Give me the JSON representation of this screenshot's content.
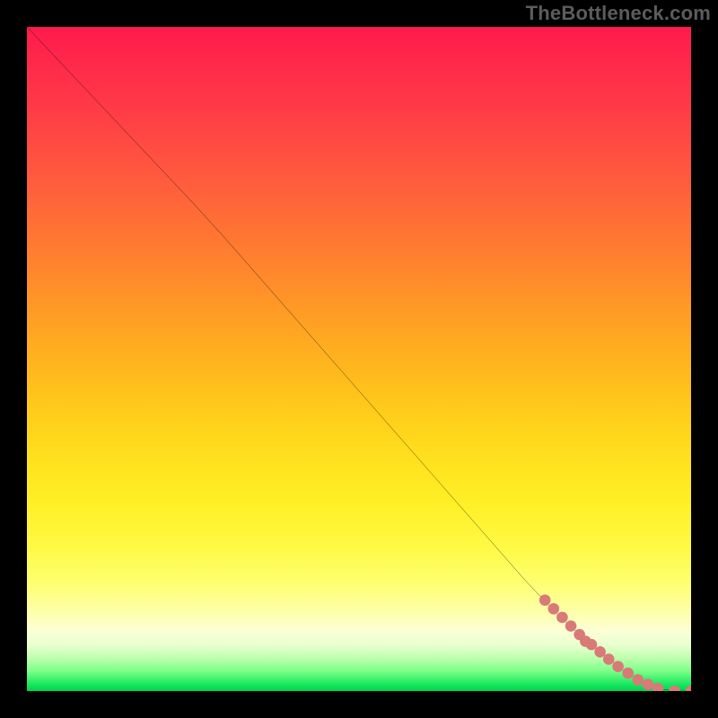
{
  "watermark": "TheBottleneck.com",
  "chart_data": {
    "type": "line",
    "title": "",
    "xlabel": "",
    "ylabel": "",
    "x_range": [
      0,
      100
    ],
    "y_range": [
      0,
      100
    ],
    "gradient_stops": [
      {
        "pct": 0,
        "color": "#ff1a4d"
      },
      {
        "pct": 25,
        "color": "#ff6a39"
      },
      {
        "pct": 50,
        "color": "#ffb520"
      },
      {
        "pct": 75,
        "color": "#fff234"
      },
      {
        "pct": 90,
        "color": "#fdffc0"
      },
      {
        "pct": 100,
        "color": "#00d24f"
      }
    ],
    "series": [
      {
        "name": "curve",
        "kind": "line",
        "color": "#000000",
        "x": [
          0,
          5,
          10,
          15,
          20,
          25,
          30,
          35,
          40,
          45,
          50,
          55,
          60,
          65,
          70,
          75,
          80,
          85,
          90,
          92,
          94,
          96,
          98,
          100
        ],
        "y": [
          100,
          94.7,
          89.4,
          84.1,
          78.8,
          73.5,
          68.0,
          62.3,
          56.6,
          50.9,
          45.2,
          39.5,
          33.8,
          28.1,
          22.4,
          16.7,
          11.4,
          7.0,
          3.0,
          1.7,
          0.8,
          0.2,
          0.0,
          0.0
        ]
      },
      {
        "name": "dots",
        "kind": "scatter",
        "color": "#d87a78",
        "x": [
          78.0,
          79.3,
          80.6,
          81.9,
          83.2,
          84.1,
          85.0,
          86.3,
          87.6,
          89.0,
          90.5,
          92.0,
          93.5,
          95.0,
          97.5,
          100.0
        ],
        "y": [
          13.7,
          12.4,
          11.1,
          9.8,
          8.5,
          7.5,
          7.0,
          5.9,
          4.8,
          3.7,
          2.7,
          1.7,
          1.0,
          0.4,
          0.0,
          0.0
        ]
      }
    ]
  }
}
